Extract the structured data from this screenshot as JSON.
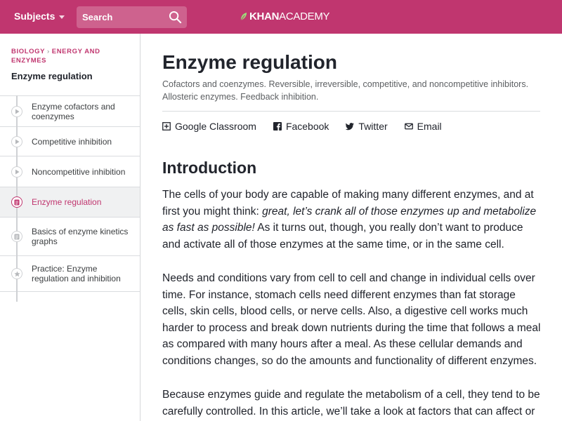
{
  "header": {
    "subjects_label": "Subjects",
    "search_placeholder": "Search",
    "logo_bold": "KHAN",
    "logo_regular": "ACADEMY",
    "brand_color": "#c0366f"
  },
  "sidebar": {
    "breadcrumb": [
      "BIOLOGY",
      "ENERGY AND ENZYMES"
    ],
    "title": "Enzyme regulation",
    "items": [
      {
        "label": "Enzyme cofactors and coenzymes",
        "icon": "play-icon",
        "active": false
      },
      {
        "label": "Competitive inhibition",
        "icon": "play-icon",
        "active": false
      },
      {
        "label": "Noncompetitive inhibition",
        "icon": "play-icon",
        "active": false
      },
      {
        "label": "Enzyme regulation",
        "icon": "article-icon",
        "active": true
      },
      {
        "label": "Basics of enzyme kinetics graphs",
        "icon": "article-icon",
        "active": false
      },
      {
        "label": "Practice: Enzyme regulation and inhibition",
        "icon": "star-icon",
        "active": false
      }
    ]
  },
  "main": {
    "title": "Enzyme regulation",
    "description": "Cofactors and coenzymes. Reversible, irreversible, competitive, and noncompetitive inhibitors. Allosteric enzymes. Feedback inhibition.",
    "share": {
      "google_classroom": "Google Classroom",
      "facebook": "Facebook",
      "twitter": "Twitter",
      "email": "Email"
    },
    "heading": "Introduction",
    "p1_a": "The cells of your body are capable of making many different enzymes, and at first you might think: ",
    "p1_em": "great, let’s crank all of those enzymes up and metabolize as fast as possible!",
    "p1_b": " As it turns out, though, you really don’t want to produce and activate all of those enzymes at the same time, or in the same cell.",
    "p2": "Needs and conditions vary from cell to cell and change in individual cells over time. For instance, stomach cells need different enzymes than fat storage cells, skin cells, blood cells, or nerve cells. Also, a digestive cell works much harder to process and break down nutrients during the time that follows a meal as compared with many hours after a meal. As these cellular demands and conditions changes, so do the amounts and functionality of different enzymes.",
    "p3": "Because enzymes guide and regulate the metabolism of a cell, they tend to be carefully controlled. In this article, we’ll take a look at factors that can affect or"
  }
}
